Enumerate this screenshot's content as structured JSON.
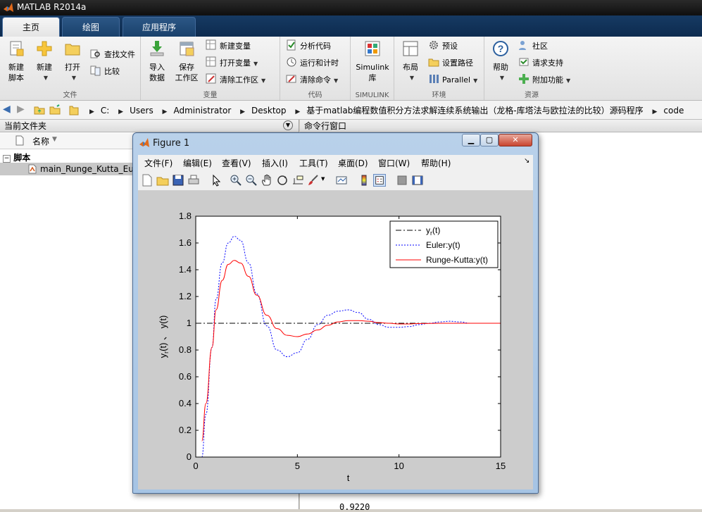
{
  "window": {
    "title": "MATLAB R2014a"
  },
  "tabs": [
    {
      "label": "主页",
      "active": true
    },
    {
      "label": "绘图",
      "active": false
    },
    {
      "label": "应用程序",
      "active": false
    }
  ],
  "ribbon": {
    "file": {
      "section_label": "文件",
      "new_script": "新建\n脚本",
      "new": "新建",
      "open": "打开",
      "find_files": "查找文件",
      "compare": "比较"
    },
    "variable": {
      "section_label": "变量",
      "import_data": "导入\n数据",
      "save_workspace": "保存\n工作区",
      "new_variable": "新建变量",
      "open_variable": "打开变量",
      "clear_workspace": "清除工作区"
    },
    "code": {
      "section_label": "代码",
      "analyze_code": "分析代码",
      "run_and_time": "运行和计时",
      "clear_commands": "清除命令"
    },
    "simulink": {
      "section_label": "SIMULINK",
      "simulink_library": "Simulink\n库"
    },
    "environment": {
      "section_label": "环境",
      "layout": "布局",
      "preferences": "预设",
      "set_path": "设置路径",
      "parallel": "Parallel"
    },
    "resources": {
      "section_label": "资源",
      "help": "帮助",
      "community": "社区",
      "request_support": "请求支持",
      "add_ons": "附加功能"
    }
  },
  "address_bar": {
    "crumbs": [
      "C:",
      "Users",
      "Administrator",
      "Desktop",
      "基于matlab编程数值积分方法求解连续系统输出（龙格-库塔法与欧拉法的比较）源码程序",
      "code"
    ]
  },
  "current_folder": {
    "title": "当前文件夹",
    "column_name": "名称",
    "group_label": "脚本",
    "file_name": "main_Runge_Kutta_Euler.m"
  },
  "command_window": {
    "title": "命令行窗口",
    "last_output": "0.9220"
  },
  "figure": {
    "title": "Figure 1",
    "menu": [
      "文件(F)",
      "编辑(E)",
      "查看(V)",
      "插入(I)",
      "工具(T)",
      "桌面(D)",
      "窗口(W)",
      "帮助(H)"
    ]
  },
  "chart_data": {
    "type": "line",
    "xlabel": "t",
    "ylabel": "y_r(t) 、 y(t)",
    "xlim": [
      0,
      15
    ],
    "ylim": [
      0,
      1.8
    ],
    "xticks": [
      0,
      5,
      10,
      15
    ],
    "yticks": [
      0,
      0.2,
      0.4,
      0.6,
      0.8,
      1,
      1.2,
      1.4,
      1.6,
      1.8
    ],
    "legend_position": "top-right",
    "series": [
      {
        "name": "y_r(t)",
        "style": "dash-dot",
        "color": "#000000",
        "x": [
          0,
          15
        ],
        "y": [
          1,
          1
        ]
      },
      {
        "name": "Euler:y(t)",
        "style": "dotted",
        "color": "#0000ff",
        "x": [
          0.3,
          0.5,
          0.8,
          1.0,
          1.3,
          1.6,
          1.9,
          2.2,
          2.6,
          3.0,
          3.5,
          4.0,
          4.5,
          5.0,
          5.5,
          6.0,
          6.5,
          7.0,
          7.5,
          8.0,
          8.5,
          9.0,
          9.5,
          10.0,
          10.5,
          11.0,
          11.5,
          12.0,
          12.5,
          13.0,
          13.5,
          14.0,
          15.0
        ],
        "y": [
          0,
          0.32,
          0.82,
          1.18,
          1.45,
          1.6,
          1.65,
          1.62,
          1.45,
          1.22,
          0.98,
          0.8,
          0.75,
          0.78,
          0.88,
          0.99,
          1.06,
          1.09,
          1.1,
          1.08,
          1.03,
          0.99,
          0.97,
          0.97,
          0.975,
          0.99,
          1.0,
          1.01,
          1.015,
          1.01,
          1.0,
          1.0,
          1.0
        ]
      },
      {
        "name": "Runge-Kutta:y(t)",
        "style": "solid",
        "color": "#ff0000",
        "x": [
          0.3,
          0.5,
          0.8,
          1.0,
          1.3,
          1.6,
          1.9,
          2.2,
          2.6,
          3.0,
          3.5,
          4.0,
          4.5,
          5.0,
          5.5,
          6.0,
          6.5,
          7.0,
          7.5,
          8.0,
          8.5,
          9.0,
          9.5,
          10.0,
          10.5,
          11.0,
          12.0,
          13.0,
          14.0,
          15.0
        ],
        "y": [
          0.12,
          0.4,
          0.82,
          1.1,
          1.32,
          1.44,
          1.47,
          1.45,
          1.35,
          1.21,
          1.06,
          0.96,
          0.91,
          0.9,
          0.92,
          0.95,
          0.985,
          1.01,
          1.02,
          1.02,
          1.015,
          1.005,
          1.0,
          0.995,
          0.995,
          0.998,
          1.0,
          1.0,
          1.0,
          1.0
        ]
      }
    ]
  }
}
